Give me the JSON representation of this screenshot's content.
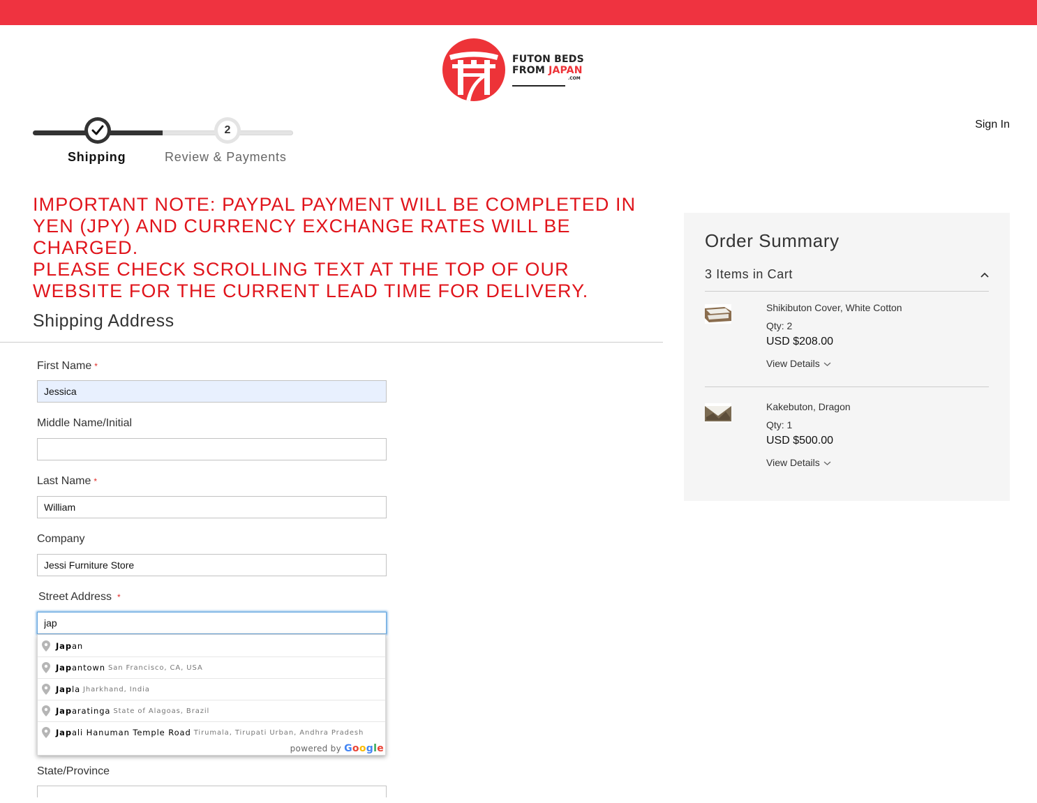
{
  "brand": {
    "line1": "FUTON BEDS",
    "line2_plain": "FROM ",
    "line2_red": "JAPAN",
    "suffix": ".COM",
    "brand_color": "#ef3340"
  },
  "header": {
    "sign_in": "Sign In"
  },
  "progress": {
    "steps": [
      {
        "number": "1",
        "label": "Shipping",
        "state": "complete"
      },
      {
        "number": "2",
        "label": "Review & Payments",
        "state": "pending"
      }
    ]
  },
  "notice": {
    "line1": "IMPORTANT NOTE: PAYPAL PAYMENT WILL BE COMPLETED IN YEN (JPY) AND CURRENCY EXCHANGE RATES WILL BE CHARGED.",
    "line2": "PLEASE CHECK SCROLLING TEXT AT THE TOP OF OUR WEBSITE FOR THE CURRENT LEAD TIME FOR DELIVERY.",
    "color": "#e0141b"
  },
  "shipping": {
    "title": "Shipping Address",
    "first_name": {
      "label": "First Name",
      "value": "Jessica"
    },
    "middle_name": {
      "label": "Middle Name/Initial",
      "value": ""
    },
    "last_name": {
      "label": "Last Name",
      "value": "William"
    },
    "company": {
      "label": "Company",
      "value": "Jessi Furniture Store"
    },
    "street": {
      "label": "Street Address",
      "value": "jap"
    },
    "state": {
      "label": "State/Province",
      "value": ""
    },
    "required_mark": "*"
  },
  "autocomplete": {
    "items": [
      {
        "match": "Jap",
        "rest": "an",
        "secondary": ""
      },
      {
        "match": "Jap",
        "rest": "antown",
        "secondary": "San Francisco, CA, USA"
      },
      {
        "match": "Jap",
        "rest": "la",
        "secondary": "Jharkhand, India"
      },
      {
        "match": "Jap",
        "rest": "aratinga",
        "secondary": "State of Alagoas, Brazil"
      },
      {
        "match": "Jap",
        "rest": "ali Hanuman Temple Road",
        "secondary": "Tirumala, Tirupati Urban, Andhra Pradesh"
      }
    ],
    "powered_by": "powered by",
    "google": [
      "G",
      "o",
      "o",
      "g",
      "l",
      "e"
    ]
  },
  "order_summary": {
    "title": "Order Summary",
    "cart_count": "3 Items in Cart",
    "items": [
      {
        "name": "Shikibuton Cover, White Cotton",
        "qty": "Qty: 2",
        "price": "USD $208.00",
        "details": "View Details"
      },
      {
        "name": "Kakebuton, Dragon",
        "qty": "Qty: 1",
        "price": "USD $500.00",
        "details": "View Details"
      }
    ]
  }
}
